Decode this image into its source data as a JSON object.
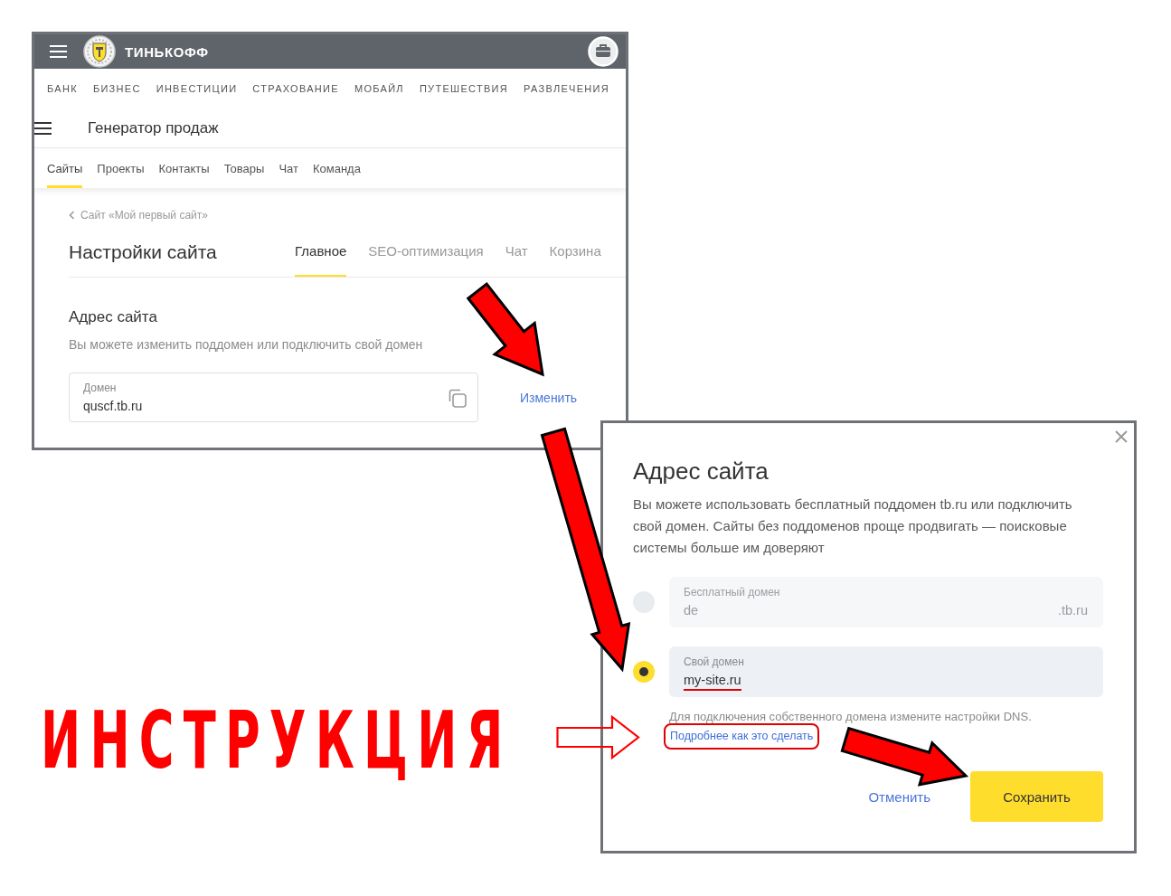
{
  "top_window": {
    "header": {
      "brand": "ТИНЬКОФФ"
    },
    "nav": [
      "БАНК",
      "БИЗНЕС",
      "ИНВЕСТИЦИИ",
      "СТРАХОВАНИЕ",
      "МОБАЙЛ",
      "ПУТЕШЕСТВИЯ",
      "РАЗВЛЕЧЕНИЯ"
    ],
    "app_title": "Генератор продаж",
    "tabs": [
      {
        "label": "Сайты",
        "selected": true
      },
      {
        "label": "Проекты",
        "selected": false
      },
      {
        "label": "Контакты",
        "selected": false
      },
      {
        "label": "Товары",
        "selected": false
      },
      {
        "label": "Чат",
        "selected": false
      },
      {
        "label": "Команда",
        "selected": false
      }
    ],
    "breadcrumb": "Сайт «Мой первый сайт»",
    "page_title": "Настройки сайта",
    "page_tabs": [
      {
        "label": "Главное",
        "selected": true
      },
      {
        "label": "SEO-оптимизация",
        "selected": false
      },
      {
        "label": "Чат",
        "selected": false
      },
      {
        "label": "Корзина",
        "selected": false
      }
    ],
    "section": {
      "title": "Адрес сайта",
      "subtitle": "Вы можете изменить поддомен или подключить свой домен",
      "field": {
        "label": "Домен",
        "value": "quscf.tb.ru"
      },
      "action": "Изменить"
    }
  },
  "modal": {
    "title": "Адрес сайта",
    "description": "Вы можете использовать бесплатный поддомен tb.ru или подключить свой домен. Сайты без поддоменов проще продвигать — поисковые системы больше им доверяют",
    "options": [
      {
        "label": "Бесплатный домен",
        "value": "de",
        "suffix": ".tb.ru",
        "selected": false,
        "disabled": true,
        "underlined": false
      },
      {
        "label": "Свой домен",
        "value": "my-site.ru",
        "selected": true,
        "disabled": false,
        "underlined": true
      }
    ],
    "hint": "Для подключения собственного домена измените настройки DNS.",
    "help_link": {
      "label": "Подробнее как это сделать",
      "highlighted": true
    },
    "buttons": [
      {
        "label": "Отменить",
        "kind": "link"
      },
      {
        "label": "Сохранить",
        "kind": "primary"
      }
    ]
  },
  "annotation": {
    "caption": "ИНСТРУКЦИЯ"
  }
}
